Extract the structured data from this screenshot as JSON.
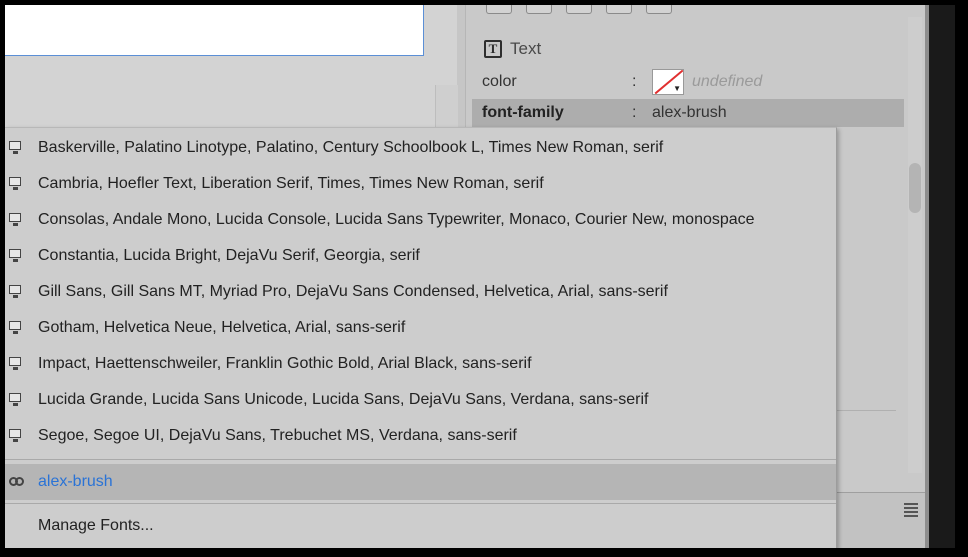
{
  "properties": {
    "section_title": "Text",
    "section_icon": "text-t-icon",
    "rows": [
      {
        "name": "color",
        "colon": ":",
        "value": "undefined"
      },
      {
        "name": "font-family",
        "colon": ":",
        "value": "alex-brush"
      }
    ]
  },
  "dropdown": {
    "system_fonts": [
      "Baskerville, Palatino Linotype, Palatino, Century Schoolbook L, Times New Roman, serif",
      "Cambria, Hoefler Text, Liberation Serif, Times, Times New Roman, serif",
      "Consolas, Andale Mono, Lucida Console, Lucida Sans Typewriter, Monaco, Courier New, monospace",
      "Constantia, Lucida Bright, DejaVu Serif, Georgia, serif",
      "Gill Sans, Gill Sans MT, Myriad Pro, DejaVu Sans Condensed, Helvetica, Arial, sans-serif",
      "Gotham, Helvetica Neue, Helvetica, Arial, sans-serif",
      "Impact, Haettenschweiler, Franklin Gothic Bold, Arial Black, sans-serif",
      "Lucida Grande, Lucida Sans Unicode, Lucida Sans, DejaVu Sans, Verdana, sans-serif",
      "Segoe, Segoe UI, DejaVu Sans, Trebuchet MS, Verdana, sans-serif"
    ],
    "web_font": "alex-brush",
    "manage_label": "Manage Fonts...",
    "web_font_color": "#2a73d6"
  }
}
